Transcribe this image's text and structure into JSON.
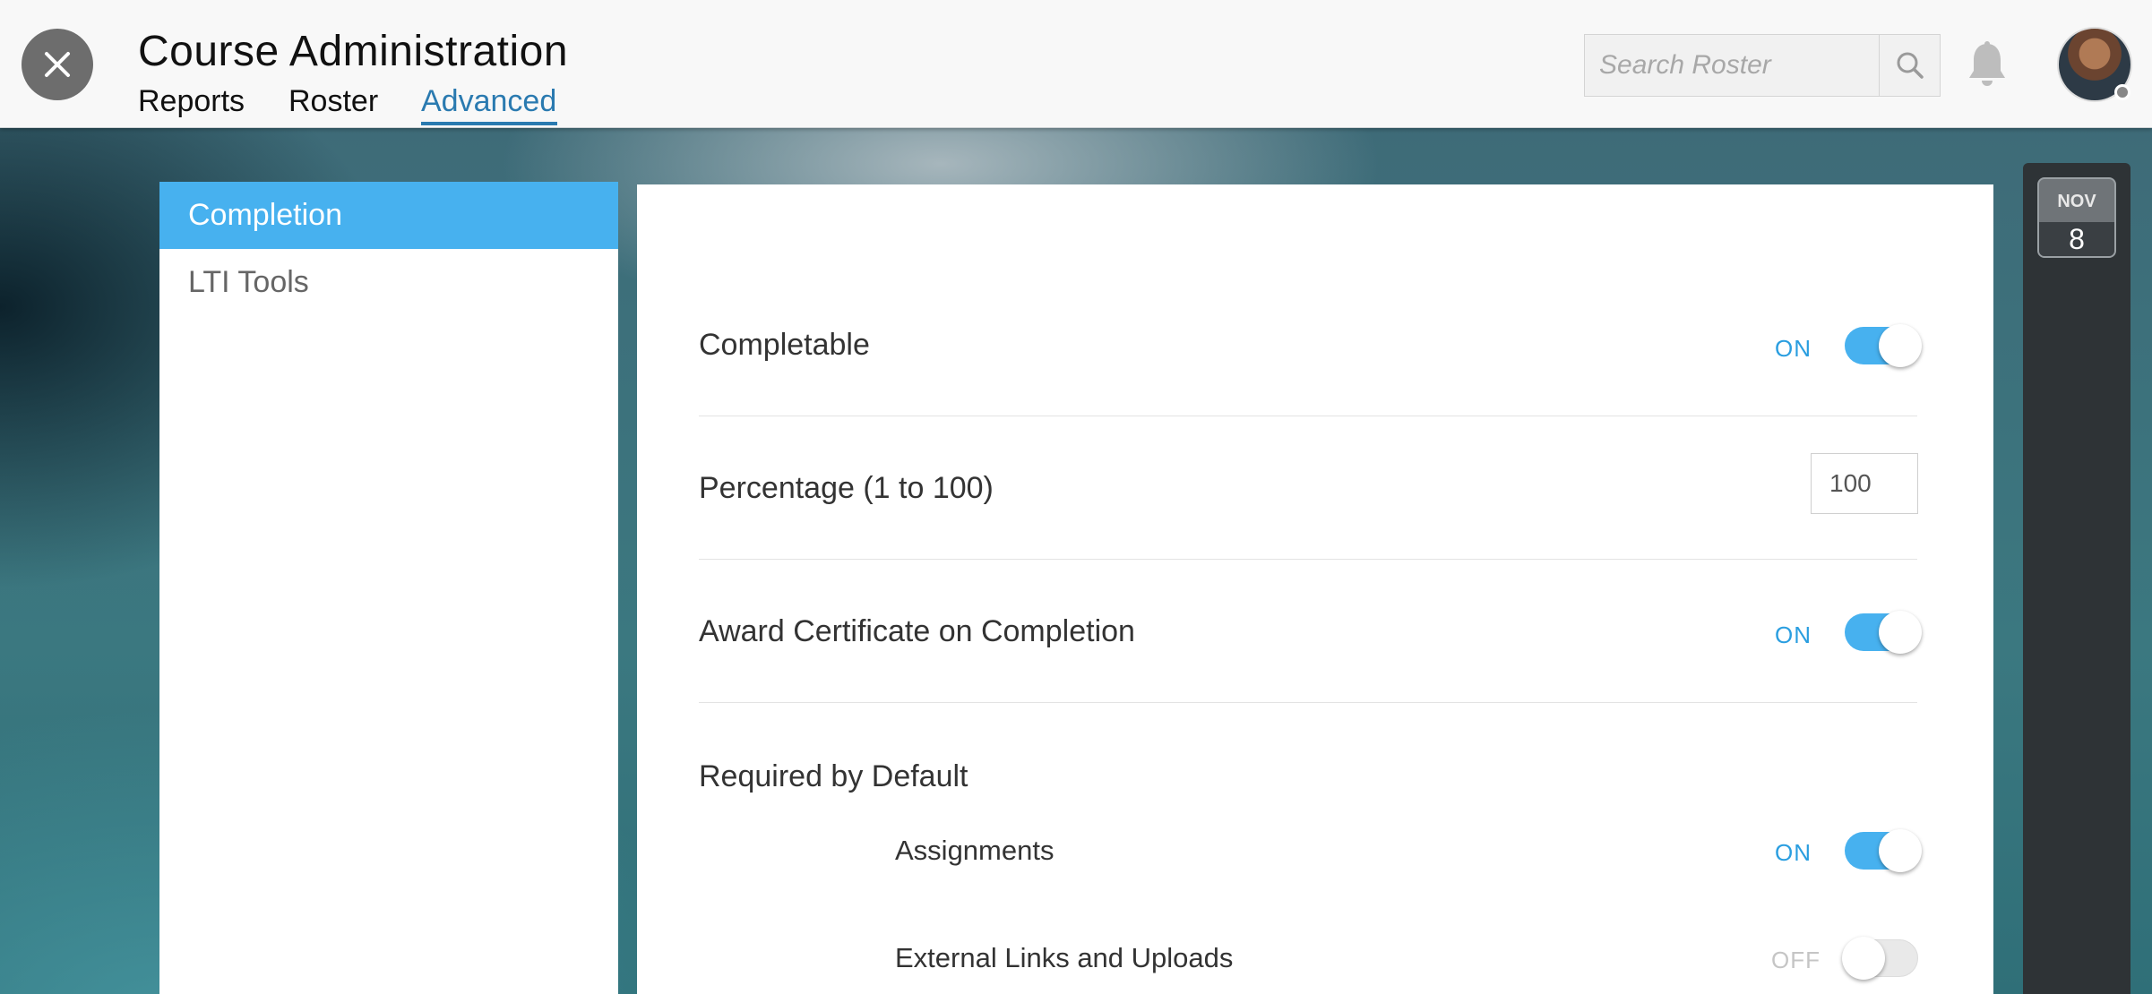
{
  "header": {
    "title": "Course Administration",
    "tabs": [
      {
        "label": "Reports",
        "active": false
      },
      {
        "label": "Roster",
        "active": false
      },
      {
        "label": "Advanced",
        "active": true
      }
    ],
    "search": {
      "placeholder": "Search Roster",
      "value": ""
    }
  },
  "sidebar": {
    "items": [
      {
        "label": "Completion",
        "active": true
      },
      {
        "label": "LTI Tools",
        "active": false
      }
    ]
  },
  "settings": {
    "completable": {
      "label": "Completable",
      "state": "ON"
    },
    "percentage": {
      "label": "Percentage (1 to 100)",
      "value": "100"
    },
    "award_certificate": {
      "label": "Award Certificate on Completion",
      "state": "ON"
    },
    "required_by_default": {
      "label": "Required by Default",
      "items": [
        {
          "label": "Assignments",
          "state": "ON"
        },
        {
          "label": "External Links and Uploads",
          "state": "OFF"
        }
      ]
    }
  },
  "date_badge": {
    "month": "NOV",
    "day": "8"
  },
  "colors": {
    "accent": "#47b1ef",
    "tab_active": "#2a7ab0",
    "on_text": "#2a9ee0",
    "off_text": "#c5c5c5"
  },
  "icons": [
    "close-icon",
    "search-icon",
    "bell-icon",
    "avatar"
  ]
}
